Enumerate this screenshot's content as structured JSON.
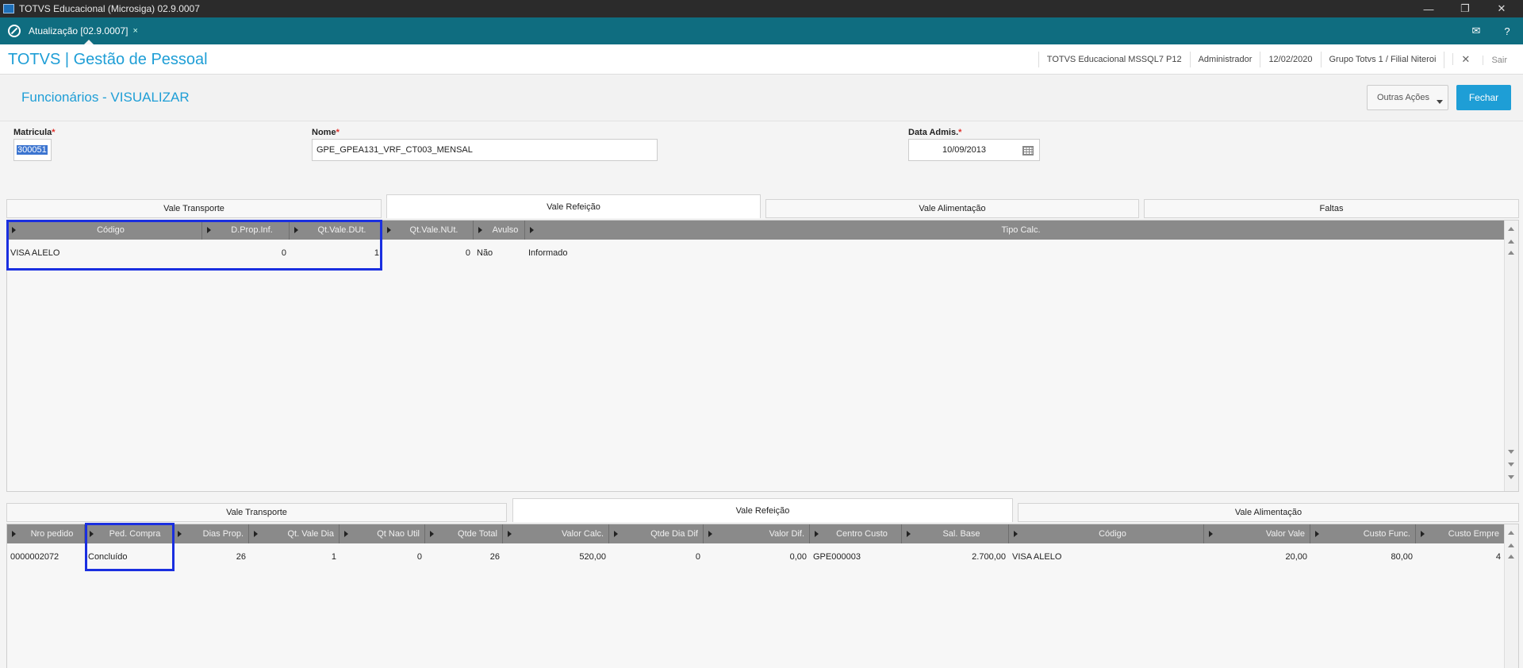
{
  "window": {
    "title": "TOTVS Educacional (Microsiga) 02.9.0007"
  },
  "tabstrip": {
    "tab_label": "Atualização [02.9.0007]",
    "tab_close": "×"
  },
  "header": {
    "brand": "TOTVS | Gestão de Pessoal",
    "environment": "TOTVS Educacional MSSQL7 P12",
    "user": "Administrador",
    "date": "12/02/2020",
    "branch": "Grupo Totvs 1 / Filial Niteroi",
    "exit_label": "Sair"
  },
  "page": {
    "title": "Funcionários - VISUALIZAR",
    "other_actions": "Outras Ações",
    "close": "Fechar"
  },
  "form": {
    "matricula_label": "Matricula",
    "matricula_value": "300051",
    "nome_label": "Nome",
    "nome_value": "GPE_GPEA131_VRF_CT003_MENSAL",
    "data_label": "Data Admis.",
    "data_value": "10/09/2013",
    "required_mark": "*"
  },
  "tabs_top": [
    "Vale Transporte",
    "Vale Refeição",
    "Vale Alimentação",
    "Faltas"
  ],
  "grid_top": {
    "headers": [
      "Código",
      "D.Prop.Inf.",
      "Qt.Vale.DUt.",
      "Qt.Vale.NUt.",
      "Avulso",
      "Tipo Calc."
    ],
    "rows": [
      [
        "VISA ALELO",
        "0",
        "1",
        "0",
        "Não",
        "Informado"
      ]
    ]
  },
  "tabs_bottom": [
    "Vale Transporte",
    "Vale Refeição",
    "Vale Alimentação"
  ],
  "grid_bottom": {
    "headers": [
      "Nro pedido",
      "Ped. Compra",
      "Dias Prop.",
      "Qt. Vale Dia",
      "Qt Nao Util",
      "Qtde Total",
      "Valor Calc.",
      "Qtde Dia Dif",
      "Valor Dif.",
      "Centro Custo",
      "Sal. Base",
      "Código",
      "Valor Vale",
      "Custo Func.",
      "Custo Empre"
    ],
    "rows": [
      [
        "0000002072",
        "Concluído",
        "26",
        "1",
        "0",
        "26",
        "520,00",
        "0",
        "0,00",
        "GPE000003",
        "2.700,00",
        "VISA ALELO",
        "20,00",
        "80,00",
        "4"
      ]
    ]
  },
  "icons": [
    "app-icon",
    "minimize-icon",
    "restore-icon",
    "close-icon",
    "totvs-logo-icon",
    "mail-icon",
    "help-icon",
    "calendar-icon",
    "column-arrow-icon",
    "scroll-up-icon",
    "scroll-down-icon"
  ],
  "colors": {
    "accent": "#1e9ed6",
    "tabstrip": "#0f6d80",
    "highlight": "#1a2fe0",
    "grid_header": "#8a8a8a"
  }
}
